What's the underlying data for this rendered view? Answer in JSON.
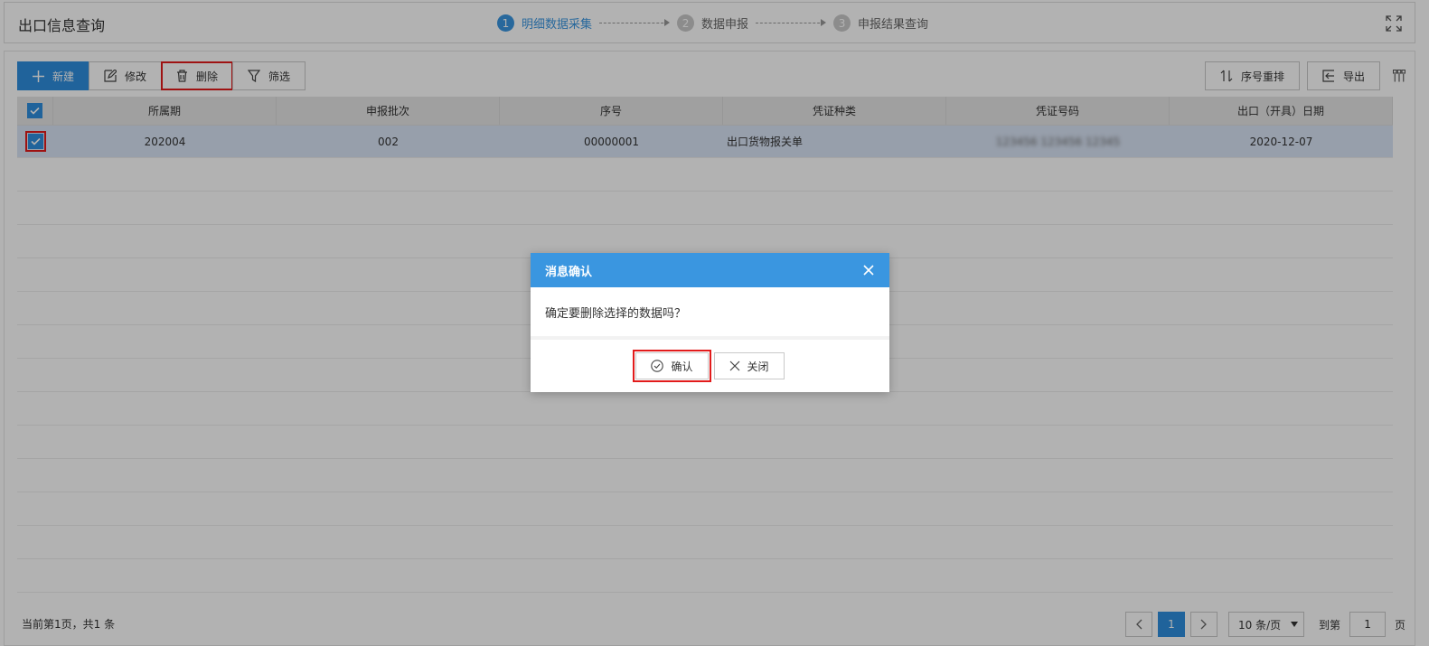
{
  "header": {
    "title": "出口信息查询",
    "steps": [
      {
        "num": "1",
        "label": "明细数据采集"
      },
      {
        "num": "2",
        "label": "数据申报"
      },
      {
        "num": "3",
        "label": "申报结果查询"
      }
    ]
  },
  "toolbar": {
    "new_label": "新建",
    "edit_label": "修改",
    "delete_label": "删除",
    "filter_label": "筛选",
    "reorder_label": "序号重排",
    "export_label": "导出"
  },
  "table": {
    "columns": [
      "所属期",
      "申报批次",
      "序号",
      "凭证种类",
      "凭证号码",
      "出口（开具）日期"
    ],
    "rows": [
      {
        "period": "202004",
        "batch": "002",
        "seq": "00000001",
        "voucher_type": "出口货物报关单",
        "voucher_no": "123456 123456 12345",
        "date": "2020-12-07"
      }
    ]
  },
  "footer": {
    "page_info": "当前第1页，共1 条",
    "current_page": "1",
    "page_size": "10 条/页",
    "goto_label": "到第",
    "goto_value": "1",
    "page_unit": "页"
  },
  "modal": {
    "title": "消息确认",
    "message": "确定要删除选择的数据吗？",
    "confirm_label": "确认",
    "close_label": "关闭"
  },
  "colors": {
    "accent": "#3a96e0",
    "primary_button": "#2e8ede",
    "highlight_box": "#e21b1b",
    "selected_row": "#d9e4f5"
  }
}
